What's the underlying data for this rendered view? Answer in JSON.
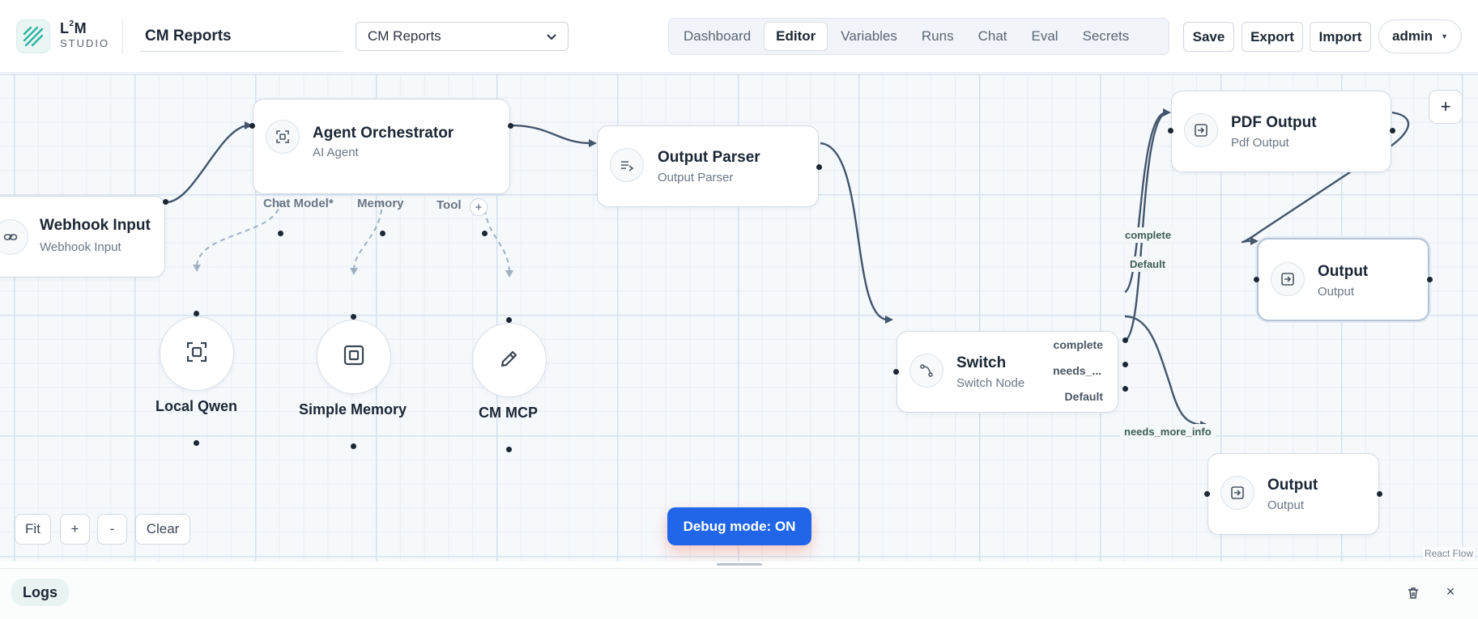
{
  "brand": {
    "logo_main": "L",
    "logo_sup": "2",
    "logo_tail": "M",
    "logo_sub": "STUDIO"
  },
  "header": {
    "project_name": "CM Reports",
    "project_select": "CM Reports",
    "tabs": [
      {
        "label": "Dashboard",
        "active": false
      },
      {
        "label": "Editor",
        "active": true
      },
      {
        "label": "Variables",
        "active": false
      },
      {
        "label": "Runs",
        "active": false
      },
      {
        "label": "Chat",
        "active": false
      },
      {
        "label": "Eval",
        "active": false
      },
      {
        "label": "Secrets",
        "active": false
      }
    ],
    "save_label": "Save",
    "export_label": "Export",
    "import_label": "Import",
    "user_label": "admin"
  },
  "nodes": {
    "webhook": {
      "title": "Webhook Input",
      "subtitle": "Webhook Input",
      "icon": "link-icon"
    },
    "agent": {
      "title": "Agent Orchestrator",
      "subtitle": "AI Agent",
      "icon": "agent-icon",
      "ports": {
        "chat_model": "Chat Model*",
        "memory": "Memory",
        "tool": "Tool",
        "add": "+"
      }
    },
    "parser": {
      "title": "Output Parser",
      "subtitle": "Output Parser",
      "icon": "parser-icon"
    },
    "switch": {
      "title": "Switch",
      "subtitle": "Switch Node",
      "icon": "branch-icon",
      "outputs": [
        "complete",
        "needs_...",
        "Default"
      ]
    },
    "pdf_output": {
      "title": "PDF Output",
      "subtitle": "Pdf Output",
      "icon": "output-icon"
    },
    "output_1": {
      "title": "Output",
      "subtitle": "Output",
      "icon": "output-icon"
    },
    "output_2": {
      "title": "Output",
      "subtitle": "Output",
      "icon": "output-icon"
    },
    "local_qwen": {
      "label": "Local Qwen",
      "icon": "model-icon"
    },
    "simple_memory": {
      "label": "Simple Memory",
      "icon": "memory-icon"
    },
    "cm_mcp": {
      "label": "CM MCP",
      "icon": "pencil-icon"
    }
  },
  "edge_labels": {
    "complete": "complete",
    "default": "Default",
    "needs_more_info": "needs_more_info"
  },
  "controls": {
    "fit": "Fit",
    "zoom_in": "+",
    "zoom_out": "-",
    "clear": "Clear",
    "add": "+"
  },
  "debug_label": "Debug mode: ON",
  "attribution": "React Flow",
  "logs": {
    "tab_label": "Logs",
    "close": "×"
  },
  "colors": {
    "accent": "#2166e8",
    "edge": "#42566d",
    "dashed_edge": "#9fb0c2",
    "logo_teal": "#2bb3a3"
  }
}
